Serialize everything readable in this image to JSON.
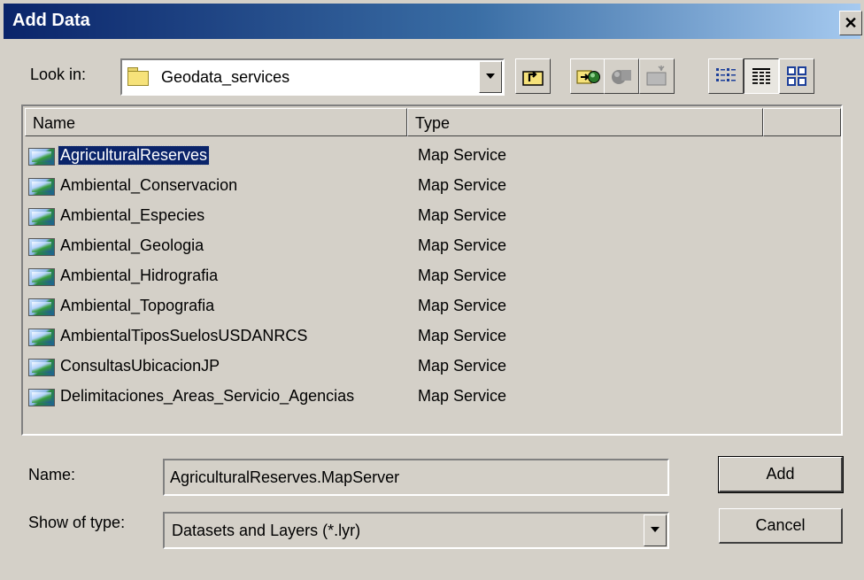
{
  "window": {
    "title": "Add Data",
    "close_glyph": "✕"
  },
  "lookin": {
    "label": "Look in:",
    "value": "Geodata_services",
    "icon": "folder-icon"
  },
  "toolbar": {
    "buttons": [
      {
        "name": "up-one-level",
        "icon": "up-folder-icon",
        "enabled": true
      },
      {
        "name": "connect-to-folder",
        "icon": "connect-folder-icon",
        "enabled": true
      },
      {
        "name": "disconnect-from-folder",
        "icon": "disconnect-folder-icon",
        "enabled": false
      },
      {
        "name": "new-folder",
        "icon": "new-folder-icon",
        "enabled": false
      },
      {
        "name": "list-view",
        "icon": "list-view-icon",
        "enabled": true
      },
      {
        "name": "details-view",
        "icon": "details-view-icon",
        "enabled": true,
        "pressed": true
      },
      {
        "name": "thumbnails-view",
        "icon": "thumbnails-view-icon",
        "enabled": true
      }
    ]
  },
  "list": {
    "columns": [
      "Name",
      "Type"
    ],
    "rows": [
      {
        "name": "AgriculturalReserves",
        "type": "Map Service",
        "selected": true
      },
      {
        "name": "Ambiental_Conservacion",
        "type": "Map Service"
      },
      {
        "name": "Ambiental_Especies",
        "type": "Map Service"
      },
      {
        "name": "Ambiental_Geologia",
        "type": "Map Service"
      },
      {
        "name": "Ambiental_Hidrografia",
        "type": "Map Service"
      },
      {
        "name": "Ambiental_Topografia",
        "type": "Map Service"
      },
      {
        "name": "AmbientalTiposSuelosUSDANRCS",
        "type": "Map Service"
      },
      {
        "name": "ConsultasUbicacionJP",
        "type": "Map Service"
      },
      {
        "name": "Delimitaciones_Areas_Servicio_Agencias",
        "type": "Map Service"
      }
    ],
    "row_icon": "map-service-icon"
  },
  "name_field": {
    "label": "Name:",
    "value": "AgriculturalReserves.MapServer"
  },
  "type_field": {
    "label": "Show of type:",
    "value": "Datasets and Layers (*.lyr)"
  },
  "buttons": {
    "add": "Add",
    "cancel": "Cancel"
  },
  "colors": {
    "dialog_bg": "#d4d0c8",
    "title_start": "#0a246a",
    "title_end": "#a6caf0",
    "selection": "#0a246a"
  }
}
